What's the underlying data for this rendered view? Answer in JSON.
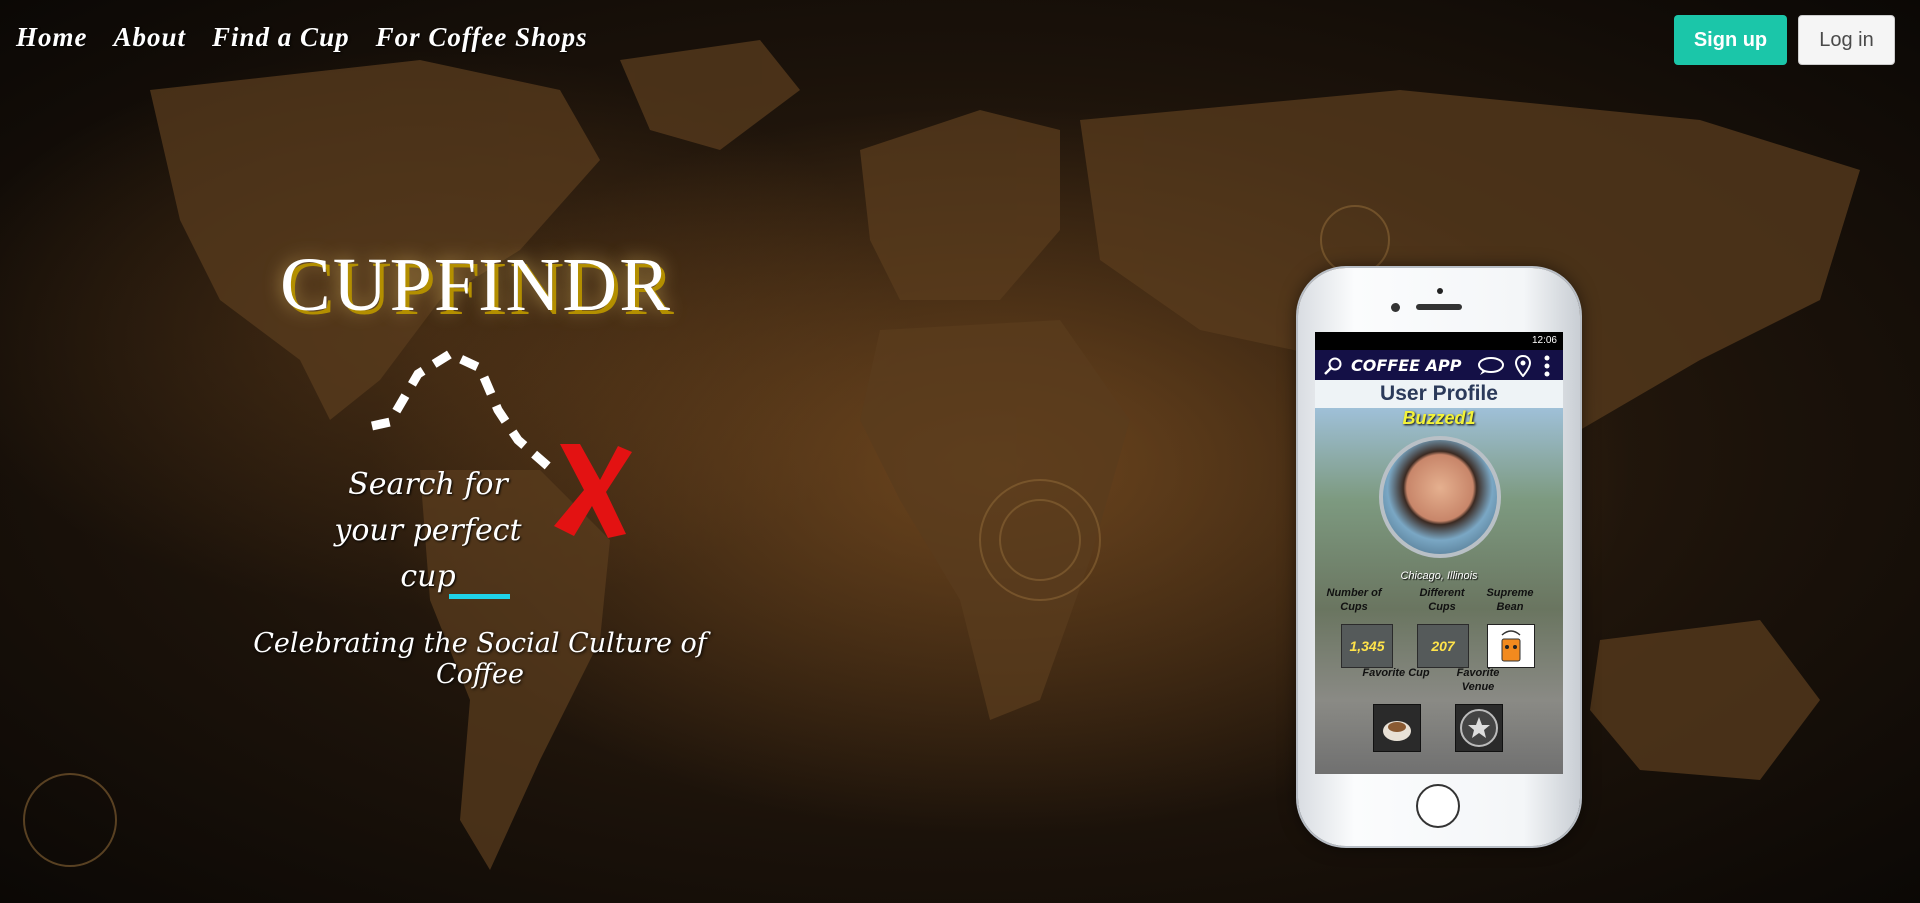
{
  "nav": {
    "home": "Home",
    "about": "About",
    "find_cup": "Find a Cup",
    "coffee_shops": "For Coffee Shops"
  },
  "auth": {
    "signup": "Sign up",
    "login": "Log in"
  },
  "hero": {
    "logo": "CUPFINDR",
    "search_line1": "Search for",
    "search_line2": "your perfect cup",
    "tagline": "Celebrating the Social Culture of Coffee"
  },
  "colors": {
    "accent_teal": "#1bc6a9",
    "cyan_bar": "#1fd3e8",
    "red_x": "#e31212",
    "app_bar": "#141046"
  },
  "phone": {
    "status_time": "12:06",
    "app_title": "COFFEE APP",
    "profile_title": "User Profile",
    "username": "Buzzed1",
    "location": "Chicago, Illinois",
    "stats": {
      "cups_label": "Number of Cups",
      "cups_value": "1,345",
      "different_label": "Different Cups",
      "different_value": "207",
      "bean_label": "Supreme Bean",
      "fav_cup_label": "Favorite Cup",
      "fav_venue_label": "Favorite Venue"
    },
    "icons": [
      "search-icon",
      "chat-icon",
      "location-pin-icon",
      "more-vert-icon"
    ]
  }
}
